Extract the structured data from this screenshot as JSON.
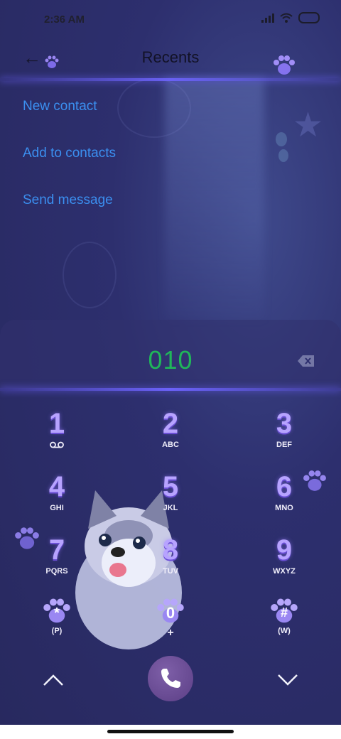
{
  "status_bar": {
    "time": "2:36 AM"
  },
  "header": {
    "title": "Recents",
    "back_icon": "back-arrow-icon"
  },
  "actions": [
    {
      "label": "New contact"
    },
    {
      "label": "Add to contacts"
    },
    {
      "label": "Send message"
    }
  ],
  "dialer": {
    "number": "010"
  },
  "keypad": [
    {
      "digit": "1",
      "letters": ""
    },
    {
      "digit": "2",
      "letters": "ABC"
    },
    {
      "digit": "3",
      "letters": "DEF"
    },
    {
      "digit": "4",
      "letters": "GHI"
    },
    {
      "digit": "5",
      "letters": "JKL"
    },
    {
      "digit": "6",
      "letters": "MNO"
    },
    {
      "digit": "7",
      "letters": "PQRS"
    },
    {
      "digit": "8",
      "letters": "TUV"
    },
    {
      "digit": "9",
      "letters": "WXYZ"
    },
    {
      "digit": "*",
      "letters": "(P)"
    },
    {
      "digit": "0",
      "letters": "+"
    },
    {
      "digit": "#",
      "letters": "(W)"
    }
  ],
  "colors": {
    "link": "#3b8ff0",
    "number": "#20b65a",
    "digit": "#b7a3ff",
    "background": "#2d2f6e",
    "call_button": "#6a4a94"
  }
}
